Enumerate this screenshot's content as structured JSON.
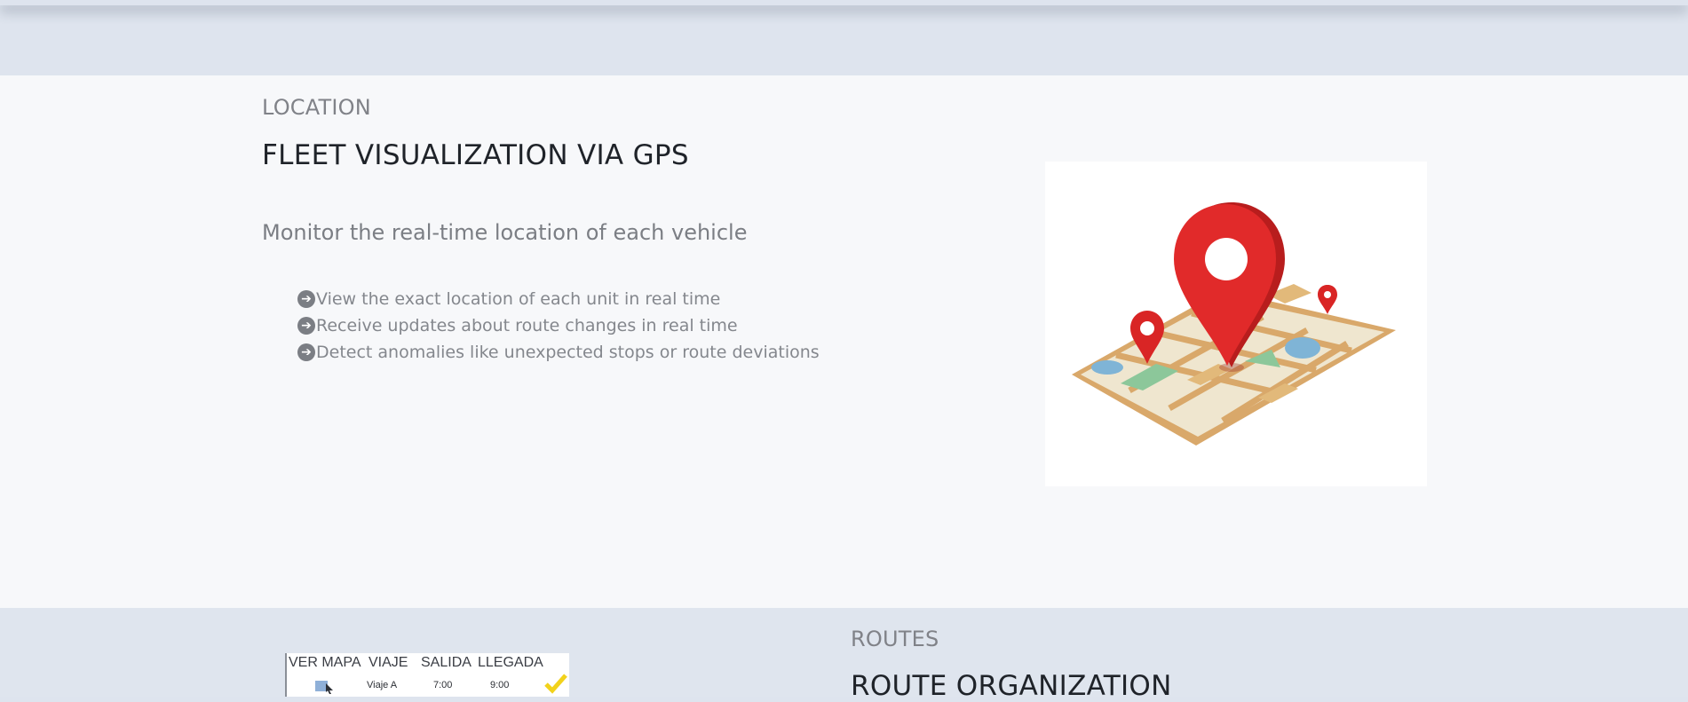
{
  "location_section": {
    "eyebrow": "LOCATION",
    "title": "FLEET VISUALIZATION VIA GPS",
    "subtitle": "Monitor the real-time location of each vehicle",
    "features": [
      "View the exact location of each unit in real time",
      "Receive updates about route changes in real time",
      "Detect anomalies like unexpected stops or route deviations"
    ],
    "image_icon": "map-with-location-pins"
  },
  "routes_section": {
    "eyebrow": "ROUTES",
    "title": "ROUTE ORGANIZATION",
    "table_image": {
      "headers": [
        "VER MAPA",
        "VIAJE",
        "SALIDA",
        "LLEGADA"
      ],
      "row": [
        "Viaje A",
        "7:00",
        "9:00"
      ],
      "status_icon": "check-icon",
      "map_icon": "map-cursor-icon"
    }
  },
  "colors": {
    "page_bg": "#dee4ee",
    "section_bg": "#f7f8fa",
    "pin_red": "#e12a2a",
    "map_tan": "#e2b97a",
    "check_yellow": "#f2d21b"
  }
}
